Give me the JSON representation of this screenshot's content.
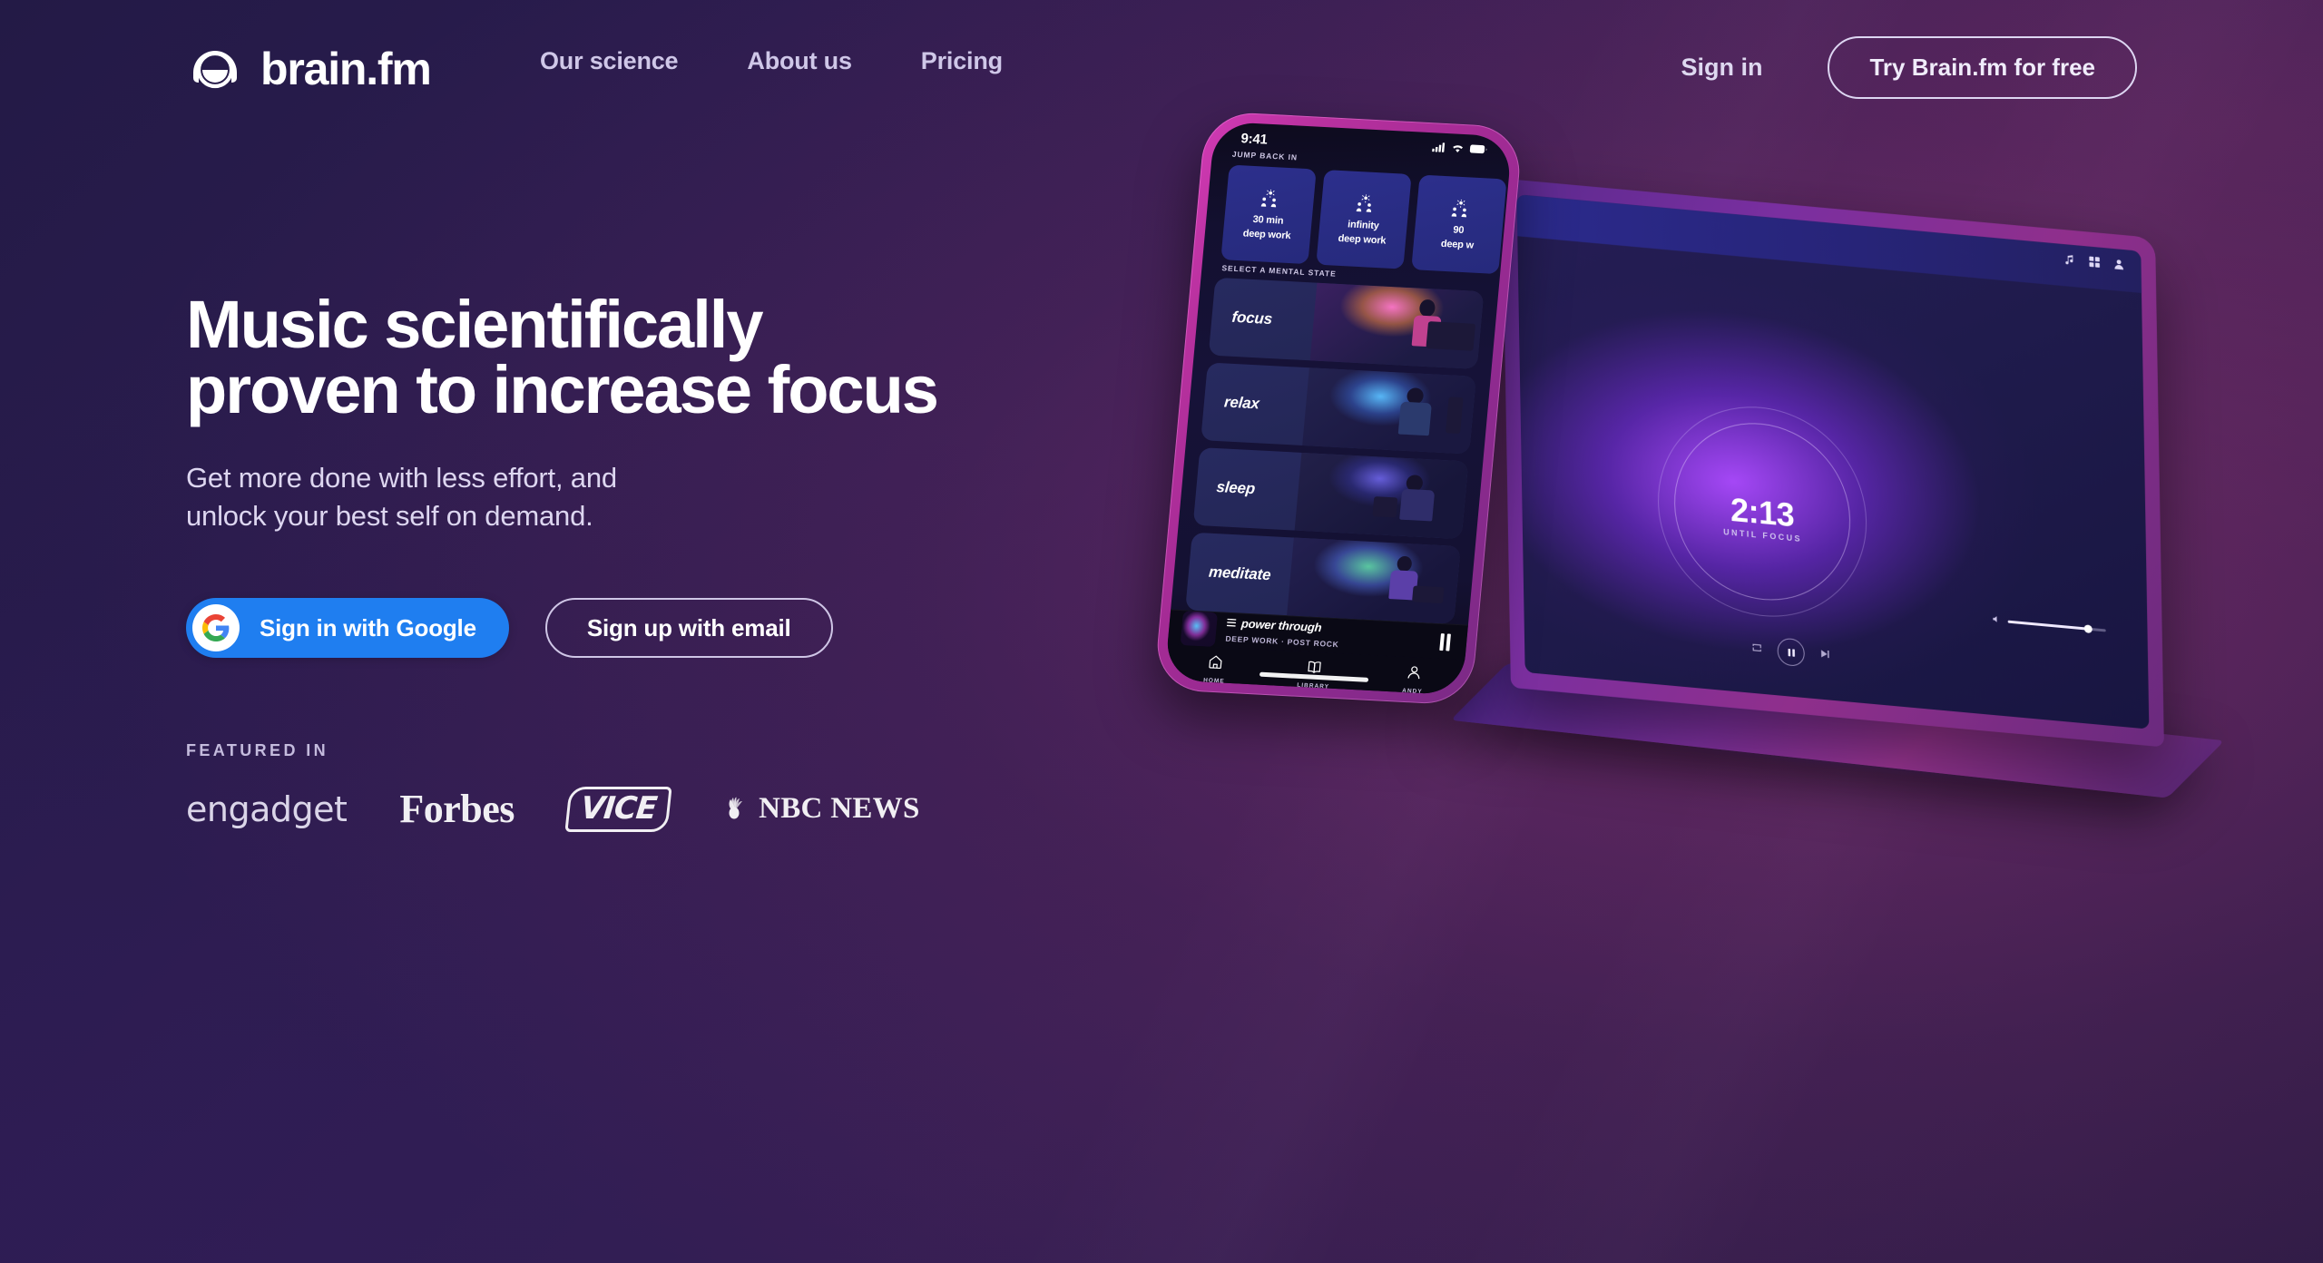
{
  "brand": {
    "name": "brain.fm",
    "logo_icon": "brainfm-headphones-logo"
  },
  "header": {
    "nav": [
      {
        "label": "Our science"
      },
      {
        "label": "About us"
      },
      {
        "label": "Pricing"
      }
    ],
    "signin_label": "Sign in",
    "cta_label": "Try Brain.fm for free"
  },
  "hero": {
    "headline": "Music scientifically\nproven to increase focus",
    "subhead": "Get more done with less effort, and\nunlock your best self on demand.",
    "google_button": {
      "label": "Sign in with Google",
      "icon": "google-g-icon"
    },
    "email_button": {
      "label": "Sign up with email"
    }
  },
  "featured": {
    "label": "FEATURED IN",
    "logos": [
      {
        "name": "engadget"
      },
      {
        "name": "Forbes"
      },
      {
        "name": "VICE"
      },
      {
        "name": "NBC NEWS"
      }
    ]
  },
  "phone": {
    "status": {
      "time": "9:41",
      "icons": [
        "cellular-signal-icon",
        "wifi-icon",
        "battery-icon"
      ]
    },
    "jump_back_in_label": "JUMP BACK IN",
    "jump_cards": [
      {
        "icon": "deep-work-icon",
        "line1": "30 min",
        "line2": "deep work"
      },
      {
        "icon": "deep-work-icon",
        "line1": "infinity",
        "line2": "deep work"
      },
      {
        "icon": "deep-work-icon",
        "line1": "90",
        "line2": "deep w"
      }
    ],
    "mental_state_label": "SELECT A MENTAL STATE",
    "states": [
      {
        "name": "focus"
      },
      {
        "name": "relax"
      },
      {
        "name": "sleep"
      },
      {
        "name": "meditate"
      }
    ],
    "player": {
      "title": "power through",
      "subtitle": "DEEP WORK · POST ROCK",
      "control_icon": "pause-icon",
      "queue_icon": "queue-lines-icon"
    },
    "tabs": [
      {
        "label": "HOME",
        "icon": "home-icon"
      },
      {
        "label": "LIBRARY",
        "icon": "book-icon"
      },
      {
        "label": "ANDY",
        "icon": "person-icon"
      }
    ]
  },
  "laptop": {
    "topbar_icons": [
      "music-note-icon",
      "grid-icon",
      "person-icon"
    ],
    "timer": {
      "value": "2:13",
      "caption": "UNTIL FOCUS"
    },
    "controls": [
      "repeat-icon",
      "pause-icon",
      "skip-next-icon"
    ],
    "volume_icon": "volume-icon"
  },
  "colors": {
    "background_start": "#231a46",
    "background_end": "#2b1b44",
    "accent_magenta": "#b9319f",
    "google_blue": "#1f7ef0",
    "text_primary": "#ffffff",
    "text_muted": "#cfc7e8"
  }
}
